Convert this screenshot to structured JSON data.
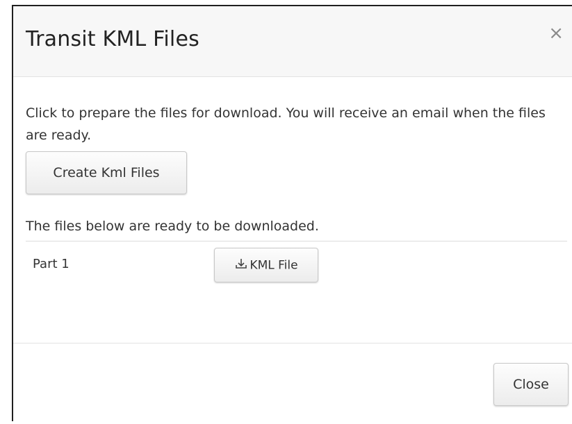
{
  "dialog": {
    "title": "Transit KML Files",
    "close_icon_glyph": "×",
    "intro_text": "Click to prepare the files for download. You will receive an email when the files are ready.",
    "create_button_label": "Create Kml Files",
    "ready_text": "The files below are ready to be downloaded.",
    "files": [
      {
        "part_label": "Part 1",
        "download_label": "KML File",
        "icon": "download-icon"
      }
    ],
    "close_button_label": "Close"
  }
}
